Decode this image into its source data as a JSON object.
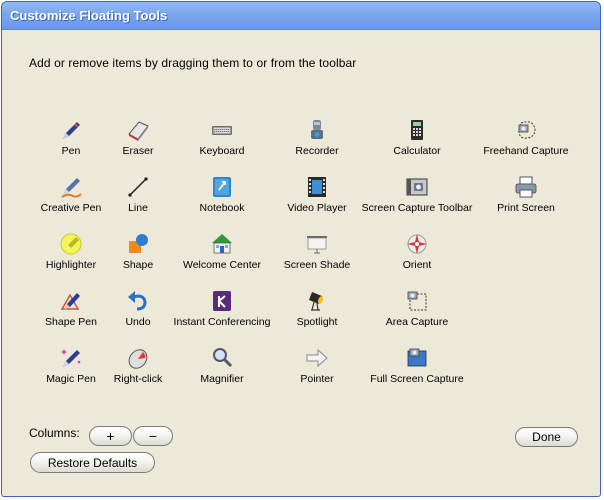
{
  "window": {
    "title": "Customize Floating Tools"
  },
  "instruction": "Add or remove items by dragging them to or from the toolbar",
  "tools": {
    "pen": "Pen",
    "eraser": "Eraser",
    "keyboard": "Keyboard",
    "recorder": "Recorder",
    "calculator": "Calculator",
    "freehand_capture": "Freehand Capture",
    "creative_pen": "Creative Pen",
    "line": "Line",
    "notebook": "Notebook",
    "video_player": "Video Player",
    "screen_capture_toolbar": "Screen Capture Toolbar",
    "print_screen": "Print Screen",
    "highlighter": "Highlighter",
    "shape": "Shape",
    "welcome_center": "Welcome Center",
    "screen_shade": "Screen Shade",
    "orient": "Orient",
    "shape_pen": "Shape Pen",
    "undo": "Undo",
    "instant_conferencing": "Instant Conferencing",
    "spotlight": "Spotlight",
    "area_capture": "Area Capture",
    "magic_pen": "Magic Pen",
    "right_click": "Right-click",
    "magnifier": "Magnifier",
    "pointer": "Pointer",
    "full_screen_capture": "Full Screen Capture"
  },
  "footer": {
    "columns_label": "Columns:",
    "plus_label": "+",
    "minus_label": "−",
    "done_label": "Done",
    "restore_label": "Restore Defaults"
  }
}
